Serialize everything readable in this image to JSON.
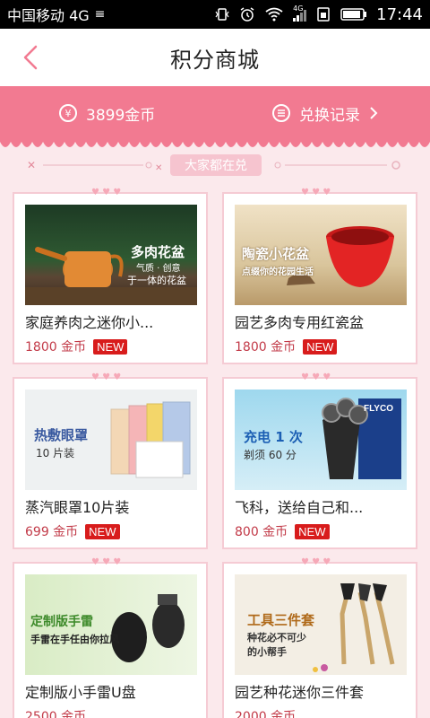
{
  "status": {
    "carrier": "中国移动 4G",
    "network_label": "4G",
    "time": "17:44"
  },
  "nav": {
    "title": "积分商城"
  },
  "banner": {
    "coin_label": "3899金币",
    "record_label": "兑换记录"
  },
  "section": {
    "title": "大家都在兑"
  },
  "products": [
    {
      "name": "家庭养肉之迷你小...",
      "price": "1800 金币",
      "badge": "NEW",
      "img_text": "多肉花盆",
      "img_sub1": "气质 · 创意",
      "img_sub2": "于一体的花盆"
    },
    {
      "name": "园艺多肉专用红瓷盆",
      "price": "1800 金币",
      "badge": "NEW",
      "img_text": "陶瓷小花盆",
      "img_sub1": "点缀你的花园生活"
    },
    {
      "name": "蒸汽眼罩10片装",
      "price": "699 金币",
      "badge": "NEW",
      "img_text": "热敷眼罩",
      "img_sub1": "10 片装"
    },
    {
      "name": "飞科，送给自己和...",
      "price": "800 金币",
      "badge": "NEW",
      "img_text": "充电 1 次",
      "img_sub1": "剃须 60 分",
      "img_brand": "FLYCO"
    },
    {
      "name": "定制版小手雷U盘",
      "price": "2500 金币",
      "img_text": "定制版手雷",
      "img_sub1": "手雷在手任由你拉风"
    },
    {
      "name": "园艺种花迷你三件套",
      "price": "2000 金币",
      "img_text": "工具三件套",
      "img_sub1": "种花必不可少",
      "img_sub2": "的小帮手"
    }
  ],
  "colors": {
    "accent": "#f27a91",
    "price": "#c23a48",
    "badge": "#d81c1c",
    "page_bg": "#fbe9ec"
  }
}
